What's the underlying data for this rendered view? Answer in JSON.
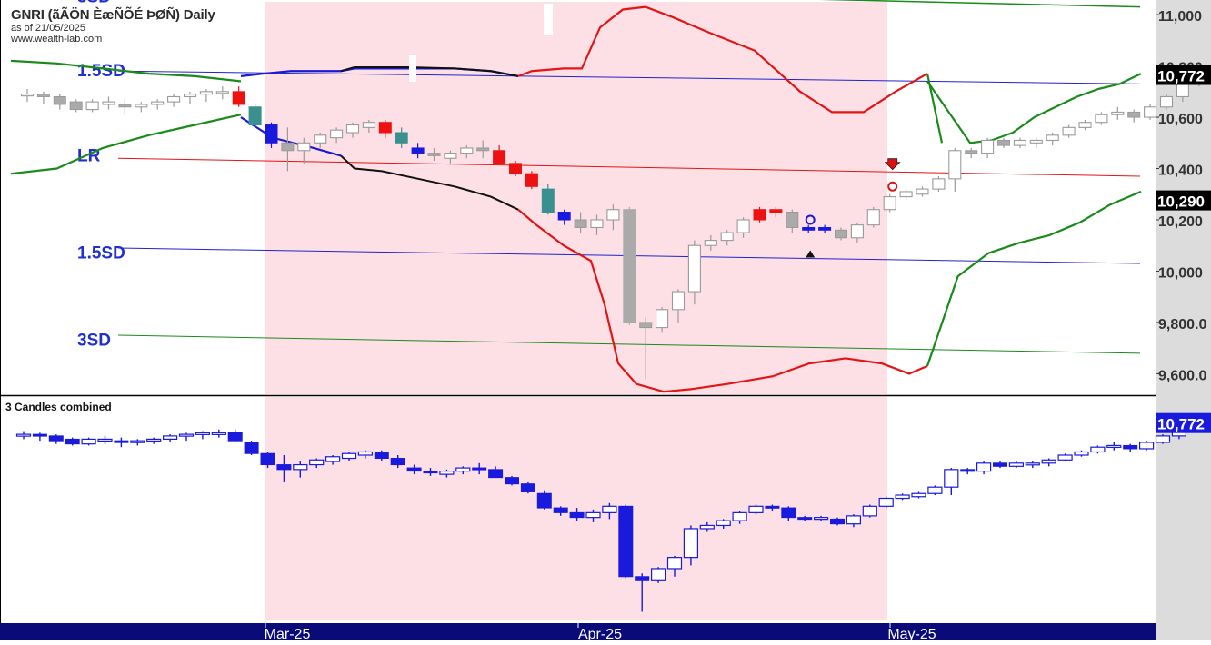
{
  "header": {
    "title": "GNRI (ãÃÖN ÈæÑÕÉ ÞØÑ) Daily",
    "as_of": "as of 21/05/2025",
    "source": "www.wealth-lab.com"
  },
  "lower_panel": {
    "title": "3 Candles combined",
    "last_value": "10,772"
  },
  "price_tags": {
    "last": "10,772",
    "regression": "10,290"
  },
  "colors": {
    "highlight": "#fde0e6",
    "axis_bg": "#dcdcdc",
    "time_bar": "#0a0a78",
    "sd_label": "#1f2fd0",
    "bull_red": "#ee1111",
    "bear_teal": "#3a8f8f",
    "blue_candle": "#1a1adc",
    "grey_candle": "#aaaaaa",
    "envelope_red": "#e31414",
    "envelope_green": "#1a8a1a"
  },
  "chart_data": [
    {
      "type": "candlestick",
      "title": "GNRI (ãÃÖN ÈæÑÕÉ ÞØÑ) Daily",
      "x_ticks": [
        "Mar-25",
        "Apr-25",
        "May-25"
      ],
      "y_ticks": [
        "11,000",
        "10,800",
        "10,600",
        "10,400",
        "10,200",
        "10,000",
        "9,800.0",
        "9,600.0"
      ],
      "ylim": [
        9520,
        11050
      ],
      "highlight_range": [
        "Mar-25",
        "May-25"
      ],
      "ohlc": [
        [
          10690,
          10710,
          10660,
          10690
        ],
        [
          10690,
          10700,
          10650,
          10680
        ],
        [
          10680,
          10690,
          10630,
          10650
        ],
        [
          10660,
          10670,
          10620,
          10630
        ],
        [
          10630,
          10670,
          10620,
          10660
        ],
        [
          10650,
          10680,
          10630,
          10660
        ],
        [
          10650,
          10670,
          10610,
          10640
        ],
        [
          10640,
          10660,
          10620,
          10650
        ],
        [
          10650,
          10670,
          10630,
          10660
        ],
        [
          10660,
          10690,
          10640,
          10680
        ],
        [
          10680,
          10700,
          10650,
          10690
        ],
        [
          10690,
          10710,
          10660,
          10700
        ],
        [
          10700,
          10720,
          10670,
          10700
        ],
        [
          10700,
          10720,
          10640,
          10650
        ],
        [
          10640,
          10650,
          10560,
          10570
        ],
        [
          10570,
          10580,
          10480,
          10500
        ],
        [
          10500,
          10560,
          10390,
          10470
        ],
        [
          10470,
          10520,
          10420,
          10500
        ],
        [
          10500,
          10540,
          10480,
          10530
        ],
        [
          10520,
          10560,
          10500,
          10550
        ],
        [
          10540,
          10580,
          10520,
          10570
        ],
        [
          10560,
          10590,
          10540,
          10580
        ],
        [
          10580,
          10590,
          10520,
          10540
        ],
        [
          10540,
          10560,
          10480,
          10500
        ],
        [
          10480,
          10500,
          10440,
          10460
        ],
        [
          10460,
          10480,
          10430,
          10450
        ],
        [
          10440,
          10470,
          10420,
          10460
        ],
        [
          10460,
          10490,
          10440,
          10480
        ],
        [
          10480,
          10510,
          10440,
          10470
        ],
        [
          10470,
          10490,
          10420,
          10420
        ],
        [
          10420,
          10430,
          10370,
          10380
        ],
        [
          10380,
          10390,
          10320,
          10330
        ],
        [
          10320,
          10340,
          10220,
          10230
        ],
        [
          10230,
          10240,
          10180,
          10200
        ],
        [
          10200,
          10230,
          10150,
          10170
        ],
        [
          10170,
          10220,
          10140,
          10200
        ],
        [
          10200,
          10260,
          10160,
          10240
        ],
        [
          10240,
          10250,
          9790,
          9800
        ],
        [
          9800,
          9820,
          9580,
          9780
        ],
        [
          9780,
          9860,
          9760,
          9850
        ],
        [
          9850,
          9930,
          9800,
          9920
        ],
        [
          9920,
          10120,
          9870,
          10100
        ],
        [
          10100,
          10140,
          10080,
          10120
        ],
        [
          10120,
          10160,
          10100,
          10150
        ],
        [
          10150,
          10210,
          10130,
          10200
        ],
        [
          10200,
          10250,
          10190,
          10240
        ],
        [
          10240,
          10250,
          10210,
          10230
        ],
        [
          10230,
          10240,
          10150,
          10170
        ],
        [
          10170,
          10180,
          10150,
          10160
        ],
        [
          10160,
          10180,
          10150,
          10170
        ],
        [
          10160,
          10170,
          10120,
          10130
        ],
        [
          10130,
          10190,
          10110,
          10180
        ],
        [
          10180,
          10250,
          10170,
          10240
        ],
        [
          10240,
          10300,
          10230,
          10290
        ],
        [
          10290,
          10320,
          10280,
          10310
        ],
        [
          10300,
          10330,
          10290,
          10320
        ],
        [
          10320,
          10370,
          10310,
          10360
        ],
        [
          10360,
          10480,
          10310,
          10470
        ],
        [
          10470,
          10480,
          10440,
          10460
        ],
        [
          10460,
          10520,
          10440,
          10510
        ],
        [
          10510,
          10520,
          10480,
          10490
        ],
        [
          10490,
          10520,
          10480,
          10510
        ],
        [
          10500,
          10520,
          10480,
          10510
        ],
        [
          10510,
          10540,
          10490,
          10530
        ],
        [
          10530,
          10570,
          10520,
          10560
        ],
        [
          10560,
          10590,
          10550,
          10580
        ],
        [
          10580,
          10620,
          10570,
          10610
        ],
        [
          10610,
          10640,
          10590,
          10620
        ],
        [
          10620,
          10630,
          10580,
          10600
        ],
        [
          10600,
          10650,
          10590,
          10640
        ],
        [
          10640,
          10690,
          10630,
          10680
        ],
        [
          10680,
          10750,
          10660,
          10740
        ],
        [
          10740,
          10790,
          10720,
          10772
        ]
      ],
      "regression_line": {
        "start": 10440,
        "end": 10370
      },
      "upper_band_1p5": {
        "start": 10780,
        "end": 10730
      },
      "lower_band_1p5": {
        "start": 10090,
        "end": 10030
      },
      "lower_band_3": {
        "start": 9750,
        "end": 9680
      },
      "upper_band_3": {
        "start": 11070,
        "end": 11030
      },
      "band_labels": [
        "1.5SD",
        "LR",
        "1.5SD",
        "3SD"
      ],
      "envelope_red_upper": [
        [
          10670,
          10720,
          10760,
          10770,
          10760,
          10760
        ],
        [
          10870,
          10880,
          10890,
          11000,
          11040,
          10980,
          10880,
          10760,
          10640,
          10600,
          10620,
          10680,
          10780,
          10830
        ]
      ],
      "envelope_red_lower": [
        10760,
        10720,
        10660,
        10560,
        10470,
        10410,
        10360,
        10300,
        10240,
        10120,
        10030,
        9620,
        9540,
        9540,
        9560,
        9580,
        9600,
        9630,
        9650,
        9670,
        9660,
        9620,
        9650
      ],
      "envelope_green_upper": [
        10820,
        10810,
        10790,
        10770,
        10760,
        10740,
        10620,
        10500,
        10510,
        10540,
        10600,
        10640,
        10680,
        10710,
        10730,
        10770
      ],
      "envelope_green_lower": [
        10380,
        10400,
        10480,
        10530,
        10570,
        10610,
        10620,
        10620,
        10590
      ],
      "envelope_green_lower2": [
        9630,
        9980,
        10070,
        10110,
        10140,
        10190,
        10260,
        10310
      ],
      "signal_markers": [
        "sell-arrow",
        "buy-arrow"
      ]
    },
    {
      "type": "candlestick",
      "title": "3 Candles combined",
      "ylim": [
        9560,
        10810
      ],
      "last_value": "10,772"
    }
  ]
}
